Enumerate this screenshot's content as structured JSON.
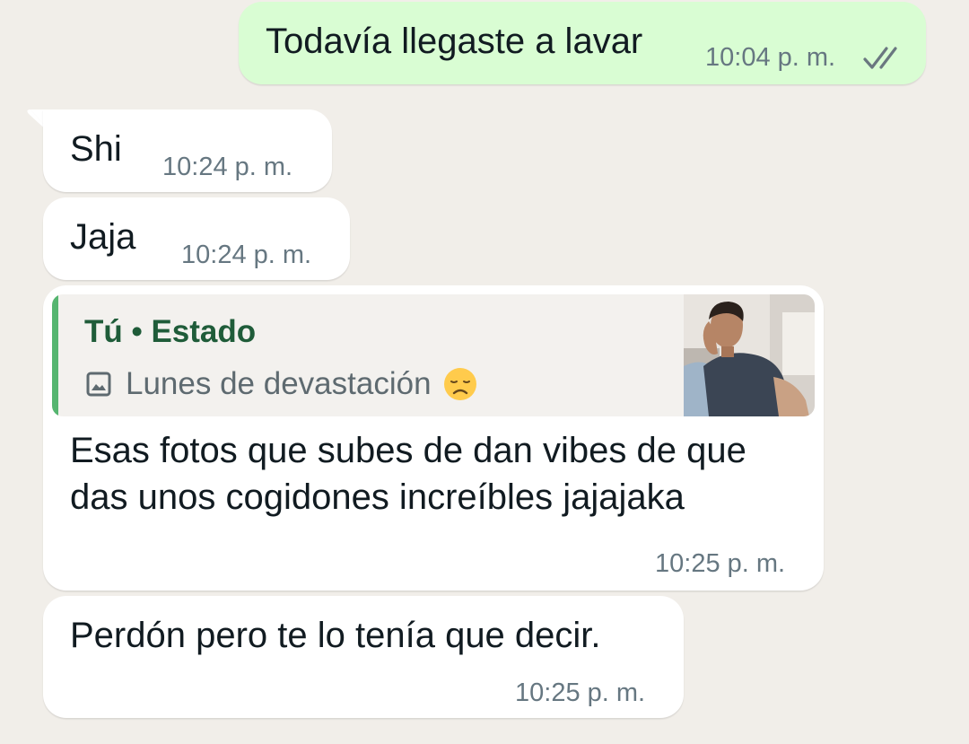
{
  "messages": [
    {
      "direction": "out",
      "text": "Todavía llegaste a lavar",
      "time": "10:04 p. m.",
      "status_icon": "double-check-icon"
    },
    {
      "direction": "in",
      "text": "Shi",
      "time": "10:24 p. m."
    },
    {
      "direction": "in",
      "text": "Jaja",
      "time": "10:24 p. m."
    },
    {
      "direction": "in",
      "quote": {
        "title": "Tú • Estado",
        "icon": "image-icon",
        "subtitle": "Lunes de devastación",
        "emoji_icon": "disappointed-face-icon",
        "thumbnail": "status-photo-thumbnail"
      },
      "text": "Esas fotos que subes de dan vibes de que das unos cogidones increíbles jajajaka",
      "time": "10:25 p. m."
    },
    {
      "direction": "in",
      "text": "Perdón pero te lo tenía que decir.",
      "time": "10:25 p. m."
    }
  ],
  "colors": {
    "chat_background": "#f1eee9",
    "outgoing_bubble": "#d9fdd3",
    "incoming_bubble": "#ffffff",
    "quote_accent": "#56b570",
    "quote_title": "#1f5c39",
    "timestamp": "#667781"
  }
}
